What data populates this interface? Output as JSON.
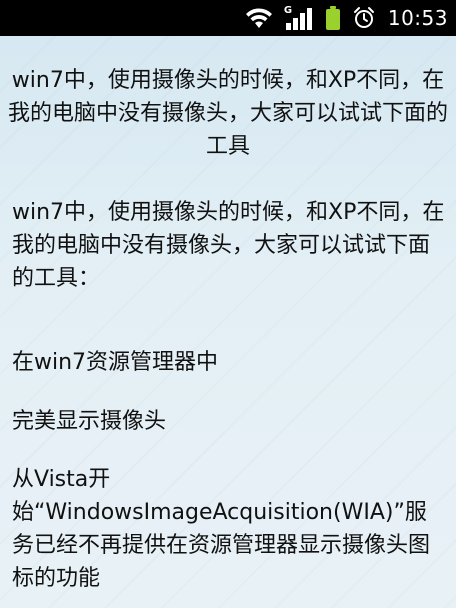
{
  "status_bar": {
    "time": "10:53",
    "icons": [
      "wifi-icon",
      "signal-icon",
      "battery-icon",
      "alarm-icon"
    ],
    "network_badge": "G"
  },
  "article": {
    "title": "win7中，使用摄像头的时候，和XP不同，在我的电脑中没有摄像头，大家可以试试下面的工具",
    "paragraphs": [
      "win7中，使用摄像头的时候，和XP不同，在我的电脑中没有摄像头，大家可以试试下面的工具：",
      "在win7资源管理器中",
      "完美显示摄像头",
      "从Vista开始“WindowsImageAcquisition(WIA)”服务已经不再提供在资源管理器显示摄像头图标的功能"
    ]
  },
  "colors": {
    "status_bar_bg": "#000000",
    "battery": "#9bd12c",
    "page_bg": "#dcebf3",
    "text": "#111111"
  }
}
